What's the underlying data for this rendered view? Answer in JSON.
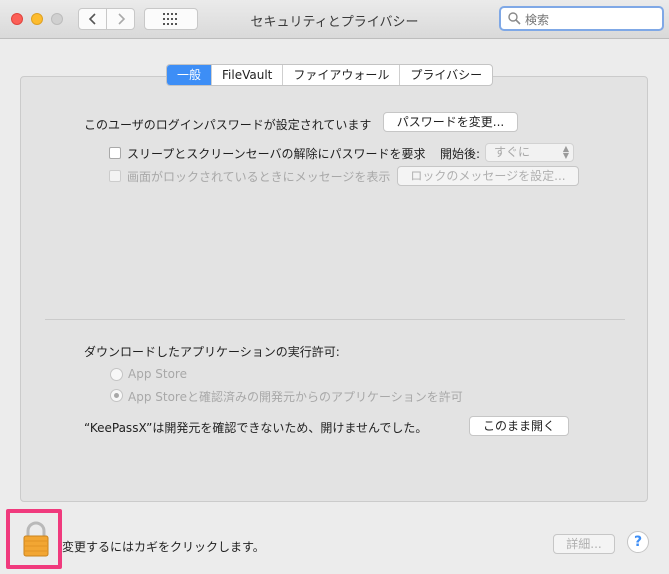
{
  "window": {
    "title": "セキュリティとプライバシー",
    "search_placeholder": "検索"
  },
  "tabs": [
    {
      "label": "一般",
      "active": true
    },
    {
      "label": "FileVault",
      "active": false
    },
    {
      "label": "ファイアウォール",
      "active": false
    },
    {
      "label": "プライバシー",
      "active": false
    }
  ],
  "general": {
    "password_text": "このユーザのログインパスワードが設定されています",
    "change_password_button": "パスワードを変更...",
    "require_password_label": "スリープとスクリーンセーバの解除にパスワードを要求",
    "require_password_checked": false,
    "start_label": "開始後:",
    "start_value": "すぐに",
    "lock_message_label": "画面がロックされているときにメッセージを表示",
    "lock_message_checked": false,
    "lock_message_button": "ロックのメッセージを設定..."
  },
  "downloads": {
    "heading": "ダウンロードしたアプリケーションの実行許可:",
    "option_app_store": "App Store",
    "option_identified": "App Storeと確認済みの開発元からのアプリケーションを許可",
    "selected_option": "option_identified",
    "blocked_message": "“KeePassX”は開発元を確認できないため、開けませんでした。",
    "open_anyway_button": "このまま開く"
  },
  "footer": {
    "lock_text": "変更するにはカギをクリックします。",
    "advanced_button": "詳細...",
    "help_label": "?"
  },
  "colors": {
    "accent": "#3d8ef6",
    "highlight_frame": "#f03a7d",
    "lock_body": "#f2a633"
  }
}
